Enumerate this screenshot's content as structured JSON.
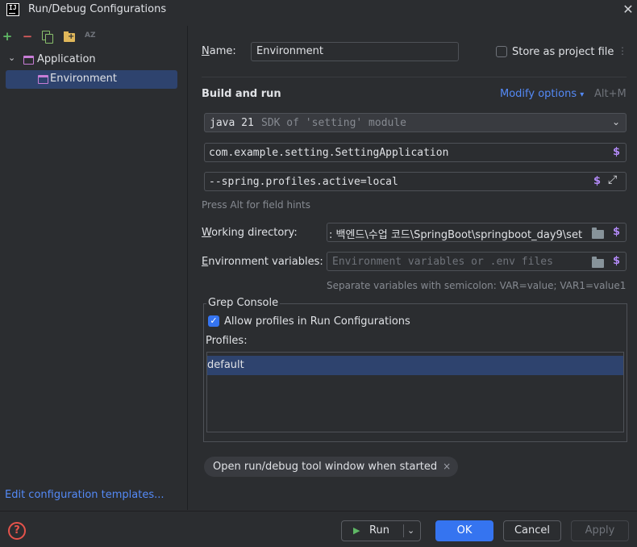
{
  "window": {
    "title": "Run/Debug Configurations",
    "icon_text": "IJ"
  },
  "toolbar": {
    "add_icon": "plus-icon",
    "remove_icon": "minus-icon",
    "copy_icon": "copy-icon",
    "folder_icon": "new-folder-icon",
    "sort_icon": "sort-az-icon",
    "sort_label": "AZ"
  },
  "tree": {
    "group": {
      "label": "Application",
      "expanded": true
    },
    "item": {
      "label": "Environment",
      "selected": true
    }
  },
  "edit_templates": "Edit configuration templates...",
  "form": {
    "name_label_u": "N",
    "name_label_rest": "ame:",
    "name_value": "Environment",
    "store_label": "Store as project file",
    "store_checked": false,
    "build_run_title": "Build and run",
    "modify_options": "Modify options",
    "modify_shortcut": "Alt+M",
    "sdk_main": "java 21",
    "sdk_desc": "SDK of 'setting' module",
    "main_class": "com.example.setting.SettingApplication",
    "program_args": "--spring.profiles.active=local",
    "field_hints": "Press Alt for field hints",
    "workdir_label_u": "W",
    "workdir_label_rest": "orking directory:",
    "workdir_value": ": 백엔드\\수업 코드\\SpringBoot\\springboot_day9\\set",
    "env_label_u": "E",
    "env_label_rest": "nvironment variables:",
    "env_placeholder": "Environment variables or .env files",
    "env_hint": "Separate variables with semicolon: VAR=value; VAR1=value1"
  },
  "grep": {
    "legend": "Grep Console",
    "allow_label": "Allow profiles in Run Configurations",
    "allow_checked": true,
    "profiles_label": "Profiles:",
    "profiles": [
      "default"
    ]
  },
  "chip": {
    "label": "Open run/debug tool window when started",
    "close": "×"
  },
  "buttons": {
    "run": "Run",
    "ok": "OK",
    "cancel": "Cancel",
    "apply": "Apply",
    "help": "?"
  },
  "colors": {
    "accent": "#3574f0",
    "link": "#548af7",
    "selection": "#2e436e",
    "dollar": "#b189f5",
    "config_icon": "#c77dd6"
  }
}
